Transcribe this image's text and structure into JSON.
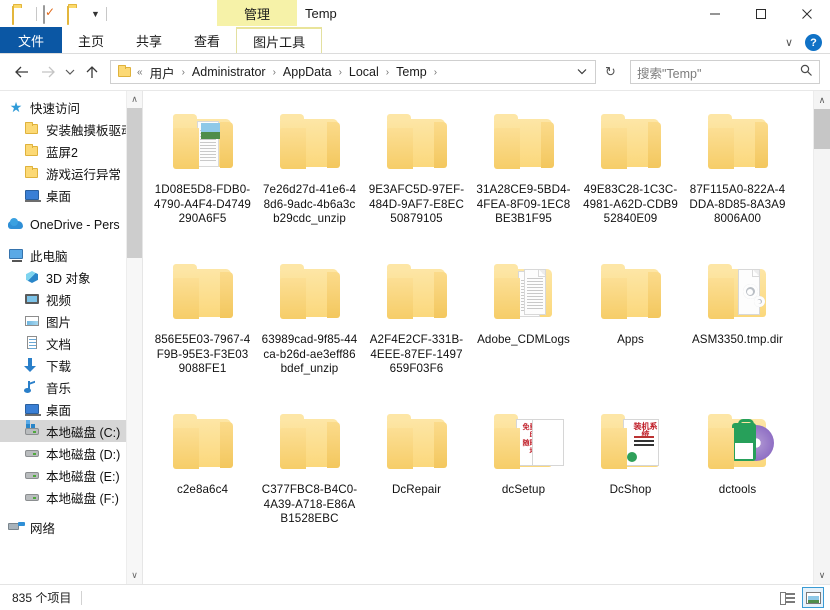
{
  "window": {
    "title": "Temp",
    "context_tab": "管理",
    "quick_access": [
      "folder-icon",
      "properties-icon",
      "new-folder-icon",
      "customize-caret"
    ],
    "controls": {
      "minimize": "—",
      "maximize": "☐",
      "close": "✕"
    }
  },
  "ribbon": {
    "tabs": [
      {
        "label": "文件",
        "kind": "file"
      },
      {
        "label": "主页",
        "kind": "normal"
      },
      {
        "label": "共享",
        "kind": "normal"
      },
      {
        "label": "查看",
        "kind": "normal"
      },
      {
        "label": "图片工具",
        "kind": "contextual"
      }
    ],
    "collapse": "∨",
    "help": "?"
  },
  "address": {
    "back": "←",
    "forward": "→",
    "recent": "∨",
    "up": "↑",
    "prefix": "«",
    "crumbs": [
      "用户",
      "Administrator",
      "AppData",
      "Local",
      "Temp"
    ],
    "separator": "›",
    "dropdown": "∨",
    "refresh": "↻"
  },
  "search": {
    "placeholder": "搜索\"Temp\"",
    "icon": "⌕"
  },
  "sidebar": {
    "items": [
      {
        "label": "快速访问",
        "icon": "star",
        "level": 1,
        "selected": false
      },
      {
        "label": "安装触摸板驱动",
        "icon": "folder",
        "level": 2,
        "selected": false
      },
      {
        "label": "蓝屏2",
        "icon": "folder",
        "level": 2,
        "selected": false
      },
      {
        "label": "游戏运行异常",
        "icon": "folder",
        "level": 2,
        "selected": false
      },
      {
        "label": "桌面",
        "icon": "desktop",
        "level": 2,
        "selected": false
      },
      {
        "label": "OneDrive - Pers",
        "icon": "onedrive",
        "level": 1,
        "selected": false,
        "gap_before": true
      },
      {
        "label": "此电脑",
        "icon": "pc",
        "level": 1,
        "selected": false,
        "gap_before": true
      },
      {
        "label": "3D 对象",
        "icon": "3d",
        "level": 2,
        "selected": false
      },
      {
        "label": "视频",
        "icon": "video",
        "level": 2,
        "selected": false
      },
      {
        "label": "图片",
        "icon": "pic",
        "level": 2,
        "selected": false
      },
      {
        "label": "文档",
        "icon": "doc",
        "level": 2,
        "selected": false
      },
      {
        "label": "下载",
        "icon": "down",
        "level": 2,
        "selected": false
      },
      {
        "label": "音乐",
        "icon": "music",
        "level": 2,
        "selected": false
      },
      {
        "label": "桌面",
        "icon": "desktop",
        "level": 2,
        "selected": false
      },
      {
        "label": "本地磁盘 (C:)",
        "icon": "diskc",
        "level": 2,
        "selected": true
      },
      {
        "label": "本地磁盘 (D:)",
        "icon": "disk",
        "level": 2,
        "selected": false
      },
      {
        "label": "本地磁盘 (E:)",
        "icon": "disk",
        "level": 2,
        "selected": false
      },
      {
        "label": "本地磁盘 (F:)",
        "icon": "disk",
        "level": 2,
        "selected": false
      },
      {
        "label": "网络",
        "icon": "net",
        "level": 1,
        "selected": false,
        "gap_before": true
      }
    ],
    "scroll_up": "∧",
    "scroll_down": "∨"
  },
  "files": [
    {
      "name": "1D08E5D8-FDB0-4790-A4F4-D4749290A6F5",
      "type": "folder-papers"
    },
    {
      "name": "7e26d27d-41e6-48d6-9adc-4b6a3cb29cdc_unzip",
      "type": "folder-empty"
    },
    {
      "name": "9E3AFC5D-97EF-484D-9AF7-E8EC50879105",
      "type": "folder-empty"
    },
    {
      "name": "31A28CE9-5BD4-4FEA-8F09-1EC8BE3B1F95",
      "type": "folder-empty"
    },
    {
      "name": "49E83C28-1C3C-4981-A62D-CDB952840E09",
      "type": "folder-empty"
    },
    {
      "name": "87F115A0-822A-4DDA-8D85-8A3A98006A00",
      "type": "folder-empty"
    },
    {
      "name": "856E5E03-7967-4F9B-95E3-F3E039088FE1",
      "type": "folder-empty"
    },
    {
      "name": "63989cad-9f85-44ca-b26d-ae3eff86bdef_unzip",
      "type": "folder-empty"
    },
    {
      "name": "A2F4E2CF-331B-4EEE-87EF-1497659F03F6",
      "type": "folder-empty"
    },
    {
      "name": "Adobe_CDMLogs",
      "type": "folder-docs"
    },
    {
      "name": "Apps",
      "type": "folder-empty"
    },
    {
      "name": "ASM3350.tmp.dir",
      "type": "folder-gear"
    },
    {
      "name": "c2e8a6c4",
      "type": "folder-empty"
    },
    {
      "name": "C377FBC8-B4C0-4A39-A718-E86AB1528EBC",
      "type": "folder-empty"
    },
    {
      "name": "DcRepair",
      "type": "folder-empty"
    },
    {
      "name": "dcSetup",
      "type": "folder-preview-blue"
    },
    {
      "name": "DcShop",
      "type": "folder-preview-poster"
    },
    {
      "name": "dctools",
      "type": "folder-preview-disc"
    }
  ],
  "status": {
    "count_text": "835 个项目",
    "views": [
      {
        "name": "details-view",
        "active": false
      },
      {
        "name": "large-icons-view",
        "active": true
      }
    ]
  }
}
